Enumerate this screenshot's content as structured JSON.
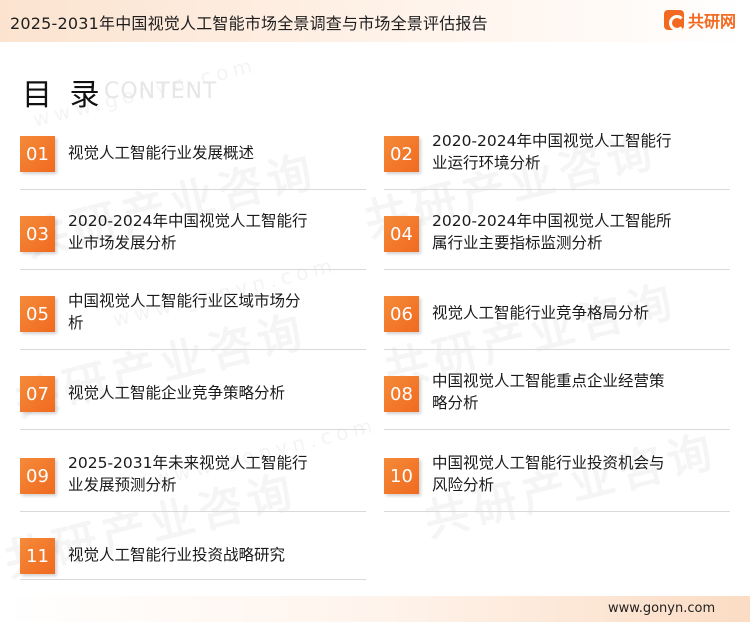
{
  "header": {
    "title": "2025-2031年中国视觉人工智能市场全景调查与市场全景评估报告",
    "logo_text": "共研网",
    "logo_icon": "gonyn-logo-icon"
  },
  "section": {
    "title": "目 录",
    "subtitle": "CONTENT"
  },
  "toc": [
    {
      "num": "01",
      "line1": "视觉人工智能行业发展概述",
      "line2": ""
    },
    {
      "num": "02",
      "line1": "2020-2024年中国视觉人工智能行",
      "line2": "业运行环境分析"
    },
    {
      "num": "03",
      "line1": "2020-2024年中国视觉人工智能行",
      "line2": "业市场发展分析"
    },
    {
      "num": "04",
      "line1": "2020-2024年中国视觉人工智能所",
      "line2": "属行业主要指标监测分析"
    },
    {
      "num": "05",
      "line1": "中国视觉人工智能行业区域市场分",
      "line2": "析"
    },
    {
      "num": "06",
      "line1": "视觉人工智能行业竞争格局分析",
      "line2": ""
    },
    {
      "num": "07",
      "line1": "视觉人工智能企业竞争策略分析",
      "line2": ""
    },
    {
      "num": "08",
      "line1": "中国视觉人工智能重点企业经营策",
      "line2": "略分析"
    },
    {
      "num": "09",
      "line1": "2025-2031年未来视觉人工智能行",
      "line2": "业发展预测分析"
    },
    {
      "num": "10",
      "line1": "中国视觉人工智能行业投资机会与",
      "line2": "风险分析"
    },
    {
      "num": "11",
      "line1": "视觉人工智能行业投资战略研究",
      "line2": ""
    }
  ],
  "watermark": {
    "brand": "共研产业咨询",
    "url": "www.gonyn.com"
  },
  "footer": {
    "url": "www.gonyn.com"
  },
  "colors": {
    "accent": "#f26a21",
    "header_bg": "#fbe3cf",
    "divider": "#d9d9d9"
  }
}
